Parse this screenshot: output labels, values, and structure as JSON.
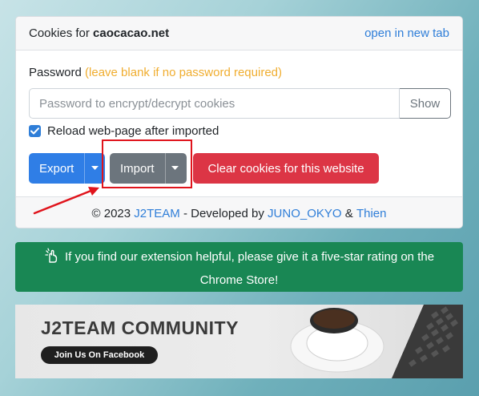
{
  "header": {
    "title_prefix": "Cookies for",
    "domain": "caocacao.net",
    "open_tab_link": "open in new tab"
  },
  "password": {
    "label": "Password",
    "hint": "(leave blank if no password required)",
    "placeholder": "Password to encrypt/decrypt cookies",
    "value": "",
    "show_button": "Show"
  },
  "reload_option": {
    "label": "Reload web-page after imported",
    "checked": true
  },
  "actions": {
    "export_label": "Export",
    "import_label": "Import",
    "clear_label": "Clear cookies for this website"
  },
  "footer": {
    "copyright": "© 2023",
    "brand": "J2TEAM",
    "developed_by": "- Developed by",
    "dev1": "JUNO_OKYO",
    "amp": "&",
    "dev2": "Thien"
  },
  "rating_banner": {
    "text_line1": "If you find our extension helpful, please give it a five-star rating on the",
    "text_line2": "Chrome Store!",
    "icon": "hand-pointer-icon"
  },
  "community": {
    "title": "J2TEAM COMMUNITY",
    "button": "Join Us On Facebook"
  },
  "colors": {
    "primary": "#2f7ee6",
    "secondary": "#6c757d",
    "danger": "#dc3545",
    "success": "#198754",
    "hint": "#f0ad2f",
    "annotation_red": "#e0141c"
  }
}
